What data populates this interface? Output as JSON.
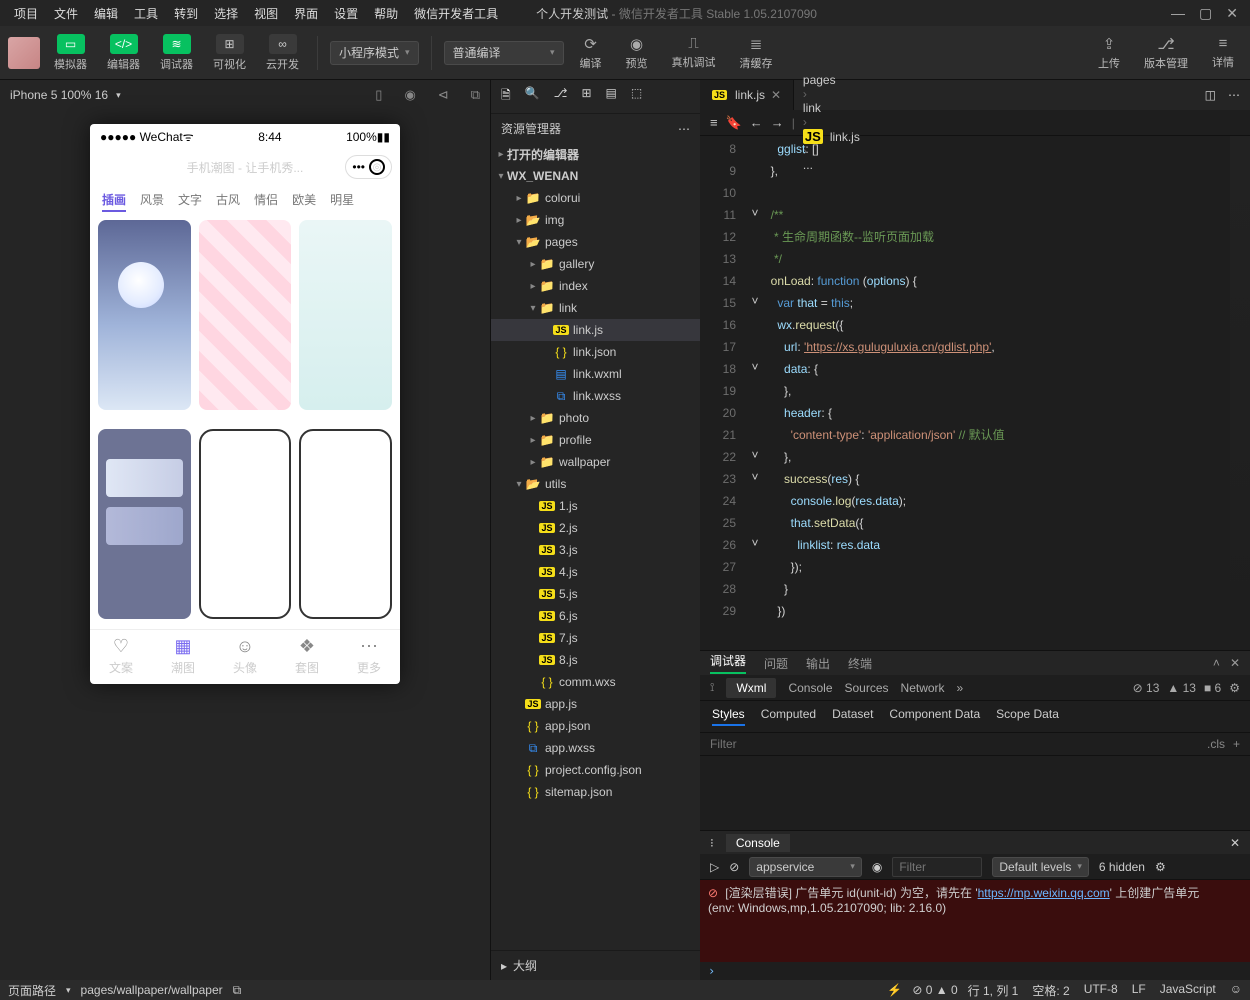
{
  "window": {
    "project_name": "个人开发测试",
    "app_title": "微信开发者工具 Stable 1.05.2107090"
  },
  "menu": [
    "项目",
    "文件",
    "编辑",
    "工具",
    "转到",
    "选择",
    "视图",
    "界面",
    "设置",
    "帮助",
    "微信开发者工具"
  ],
  "toolbar": {
    "sim": "模拟器",
    "editor": "编辑器",
    "dbg": "调试器",
    "vis": "可视化",
    "cloud": "云开发",
    "mode": "小程序模式",
    "compile": "普通编译",
    "run": "编译",
    "preview": "预览",
    "remote": "真机调试",
    "clear": "清缓存",
    "upload": "上传",
    "ver": "版本管理",
    "detail": "详情"
  },
  "sim": {
    "device": "iPhone 5 100% 16",
    "status_l": "●●●●● WeChat",
    "time": "8:44",
    "bat": "100%",
    "title": "手机潮图 - 让手机秀...",
    "tabs": [
      "插画",
      "风景",
      "文字",
      "古风",
      "情侣",
      "欧美",
      "明星"
    ],
    "nav": [
      {
        "l": "文案",
        "i": "♡"
      },
      {
        "l": "潮图",
        "i": "▦",
        "a": true
      },
      {
        "l": "头像",
        "i": "☺"
      },
      {
        "l": "套图",
        "i": "❖"
      },
      {
        "l": "更多",
        "i": "⋯"
      }
    ]
  },
  "explorer": {
    "title": "资源管理器",
    "outline": "大纲",
    "sections": {
      "open_editors": "打开的编辑器",
      "project": "WX_WENAN"
    },
    "tree": [
      {
        "d": 1,
        "t": "colorui",
        "i": "folder"
      },
      {
        "d": 1,
        "t": "img",
        "i": "folder-g"
      },
      {
        "d": 1,
        "t": "pages",
        "i": "folder-g",
        "o": true
      },
      {
        "d": 2,
        "t": "gallery",
        "i": "folder"
      },
      {
        "d": 2,
        "t": "index",
        "i": "folder"
      },
      {
        "d": 2,
        "t": "link",
        "i": "folder",
        "o": true
      },
      {
        "d": 3,
        "t": "link.js",
        "i": "js",
        "sel": true
      },
      {
        "d": 3,
        "t": "link.json",
        "i": "json"
      },
      {
        "d": 3,
        "t": "link.wxml",
        "i": "wxml"
      },
      {
        "d": 3,
        "t": "link.wxss",
        "i": "wxss"
      },
      {
        "d": 2,
        "t": "photo",
        "i": "folder"
      },
      {
        "d": 2,
        "t": "profile",
        "i": "folder"
      },
      {
        "d": 2,
        "t": "wallpaper",
        "i": "folder"
      },
      {
        "d": 1,
        "t": "utils",
        "i": "folder-g",
        "o": true
      },
      {
        "d": 2,
        "t": "1.js",
        "i": "js"
      },
      {
        "d": 2,
        "t": "2.js",
        "i": "js"
      },
      {
        "d": 2,
        "t": "3.js",
        "i": "js"
      },
      {
        "d": 2,
        "t": "4.js",
        "i": "js"
      },
      {
        "d": 2,
        "t": "5.js",
        "i": "js"
      },
      {
        "d": 2,
        "t": "6.js",
        "i": "js"
      },
      {
        "d": 2,
        "t": "7.js",
        "i": "js"
      },
      {
        "d": 2,
        "t": "8.js",
        "i": "js"
      },
      {
        "d": 2,
        "t": "comm.wxs",
        "i": "json"
      },
      {
        "d": 1,
        "t": "app.js",
        "i": "js"
      },
      {
        "d": 1,
        "t": "app.json",
        "i": "json"
      },
      {
        "d": 1,
        "t": "app.wxss",
        "i": "wxss"
      },
      {
        "d": 1,
        "t": "project.config.json",
        "i": "json"
      },
      {
        "d": 1,
        "t": "sitemap.json",
        "i": "json"
      }
    ]
  },
  "editor": {
    "tab": "link.js",
    "breadcrumb": [
      "pages",
      "link",
      "link.js",
      "..."
    ],
    "first_line": 8,
    "folds": {
      "11": "˅",
      "15": "˅",
      "18": "˅",
      "22": "˅",
      "23": "˅",
      "26": "˅"
    },
    "code": [
      {
        "n": 8,
        "h": "    <span class='id'>gglist</span><span class='pl'>: []</span>"
      },
      {
        "n": 9,
        "h": "  <span class='pl'>},</span>"
      },
      {
        "n": 10,
        "h": ""
      },
      {
        "n": 11,
        "h": "  <span class='cm'>/**</span>"
      },
      {
        "n": 12,
        "h": "<span class='cm'>   * 生命周期函数--监听页面加载</span>"
      },
      {
        "n": 13,
        "h": "<span class='cm'>   */</span>"
      },
      {
        "n": 14,
        "h": "  <span class='fn'>onLoad</span><span class='pl'>: </span><span class='kw'>function</span> <span class='pl'>(</span><span class='id'>options</span><span class='pl'>) {</span>"
      },
      {
        "n": 15,
        "h": "    <span class='kw'>var</span> <span class='id'>that</span> <span class='op'>=</span> <span class='kw'>this</span><span class='pl'>;</span>"
      },
      {
        "n": 16,
        "h": "    <span class='id'>wx</span><span class='pl'>.</span><span class='fn'>request</span><span class='pl'>({</span>"
      },
      {
        "n": 17,
        "h": "      <span class='id'>url</span><span class='pl'>: </span><span class='str u'>'https://xs.guluguluxia.cn/gdlist.php'</span><span class='pl'>,</span>"
      },
      {
        "n": 18,
        "h": "      <span class='id'>data</span><span class='pl'>: {</span>"
      },
      {
        "n": 19,
        "h": "      <span class='pl'>},</span>"
      },
      {
        "n": 20,
        "h": "      <span class='id'>header</span><span class='pl'>: {</span>"
      },
      {
        "n": 21,
        "h": "        <span class='str'>'content-type'</span><span class='pl'>: </span><span class='str'>'application/json'</span> <span class='cm'>// 默认值</span>"
      },
      {
        "n": 22,
        "h": "      <span class='pl'>},</span>"
      },
      {
        "n": 23,
        "h": "      <span class='fn'>success</span><span class='pl'>(</span><span class='id'>res</span><span class='pl'>) {</span>"
      },
      {
        "n": 24,
        "h": "        <span class='id'>console</span><span class='pl'>.</span><span class='fn'>log</span><span class='pl'>(</span><span class='id'>res</span><span class='pl'>.</span><span class='id'>data</span><span class='pl'>);</span>"
      },
      {
        "n": 25,
        "h": "        <span class='id'>that</span><span class='pl'>.</span><span class='fn'>setData</span><span class='pl'>({</span>"
      },
      {
        "n": 26,
        "h": "          <span class='id'>linklist</span><span class='pl'>: </span><span class='id'>res</span><span class='pl'>.</span><span class='id'>data</span>"
      },
      {
        "n": 27,
        "h": "        <span class='pl'>});</span>"
      },
      {
        "n": 28,
        "h": "      <span class='pl'>}</span>"
      },
      {
        "n": 29,
        "h": "    <span class='pl'>})</span>"
      }
    ]
  },
  "devtools": {
    "top": [
      "调试器",
      "问题",
      "输出",
      "终端"
    ],
    "panel": [
      "Wxml",
      "Console",
      "Sources",
      "Network"
    ],
    "badges": {
      "err": "13",
      "warn": "13",
      "info": "6"
    },
    "styles_tabs": [
      "Styles",
      "Computed",
      "Dataset",
      "Component Data",
      "Scope Data"
    ],
    "filter": "Filter",
    "cls": ".cls",
    "console_tab": "Console",
    "ctx": "appservice",
    "filter2": "Filter",
    "levels": "Default levels",
    "hidden": "6 hidden",
    "err_line": "[渲染层错误] 广告单元 id(unit-id) 为空，请先在 '",
    "err_link": "https://mp.weixin.qq.com",
    "err_tail": "' 上创建广告单元",
    "env": "(env: Windows,mp,1.05.2107090; lib: 2.16.0)"
  },
  "status": {
    "path_label": "页面路径",
    "path": "pages/wallpaper/wallpaper",
    "err": "0",
    "warn": "0",
    "ln": "行 1, 列 1",
    "spaces": "空格: 2",
    "enc": "UTF-8",
    "eol": "LF",
    "lang": "JavaScript"
  }
}
